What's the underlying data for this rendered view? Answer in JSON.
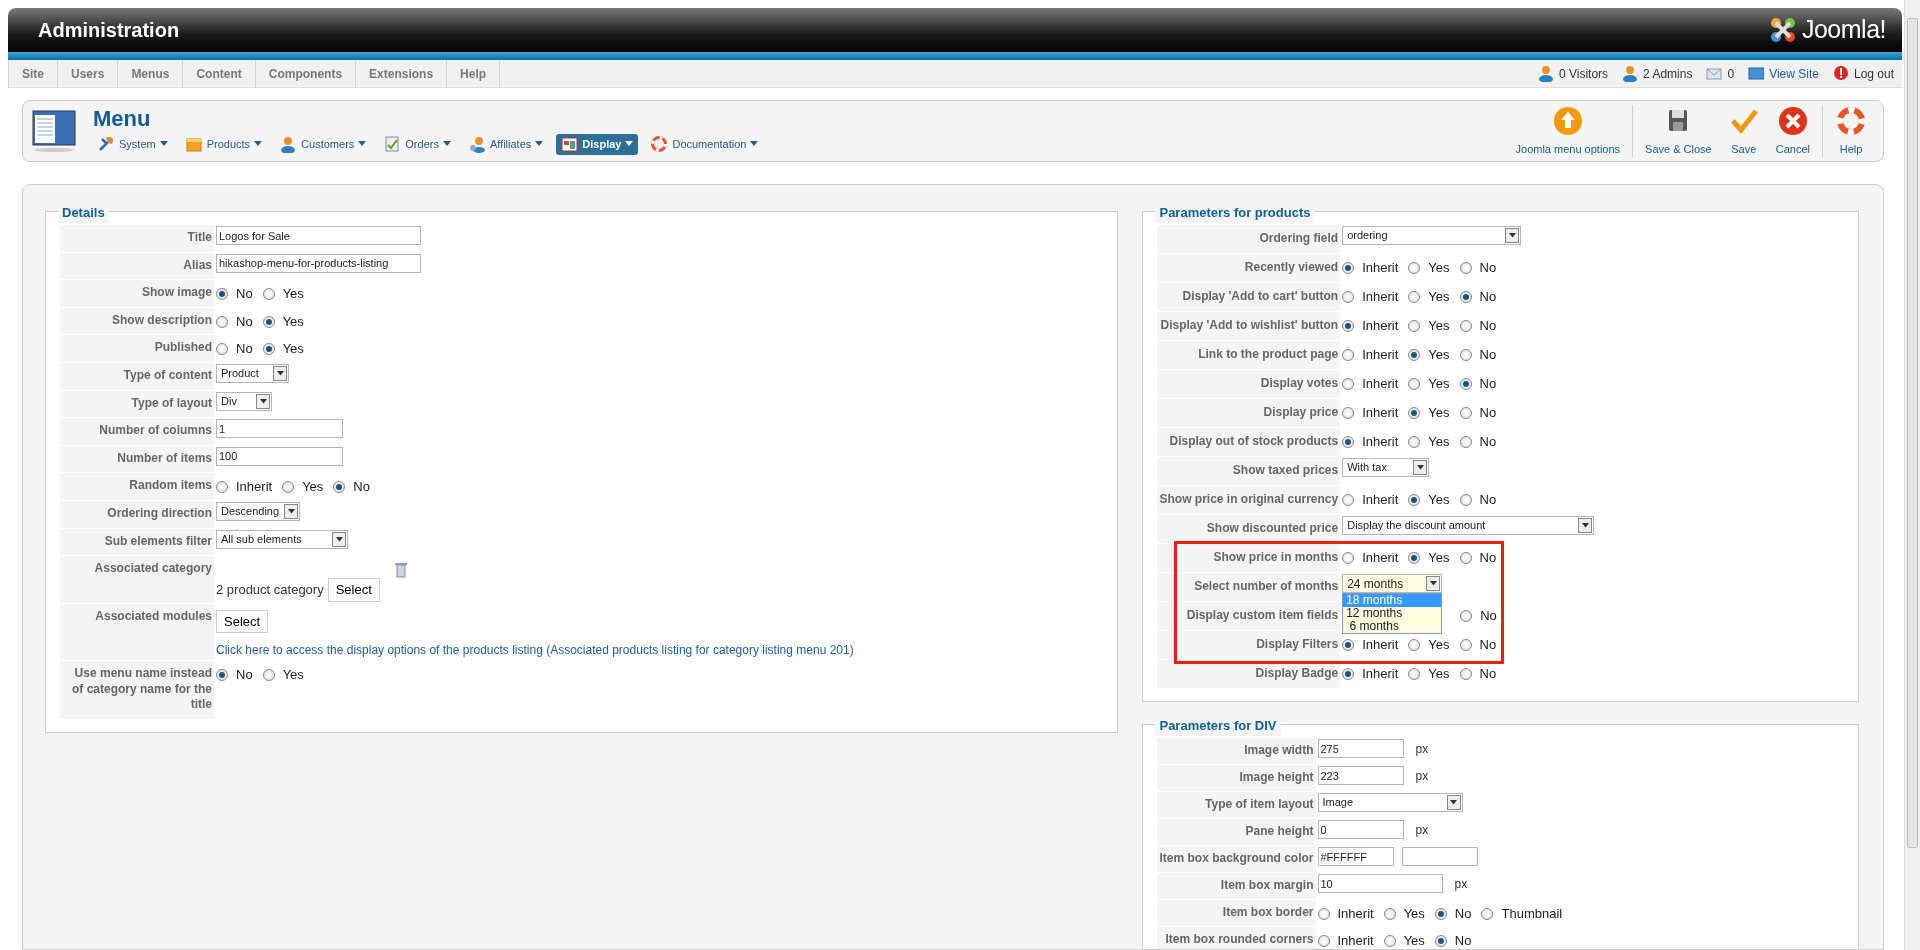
{
  "header": {
    "title": "Administration",
    "logo_text": "Joomla!"
  },
  "menu": [
    "Site",
    "Users",
    "Menus",
    "Content",
    "Components",
    "Extensions",
    "Help"
  ],
  "status": [
    {
      "kind": "visitors",
      "label": "0 Visitors"
    },
    {
      "kind": "admins",
      "label": "2 Admins"
    },
    {
      "kind": "messages",
      "label": "0"
    },
    {
      "kind": "viewsite",
      "label": "View Site"
    },
    {
      "kind": "logout",
      "label": "Log out"
    }
  ],
  "toolbar": {
    "title": "Menu",
    "submenu": [
      {
        "kind": "system",
        "label": "System",
        "selected": false
      },
      {
        "kind": "products",
        "label": "Products",
        "selected": false
      },
      {
        "kind": "customers",
        "label": "Customers",
        "selected": false
      },
      {
        "kind": "orders",
        "label": "Orders",
        "selected": false
      },
      {
        "kind": "affiliates",
        "label": "Affiliates",
        "selected": false
      },
      {
        "kind": "display",
        "label": "Display",
        "selected": true
      },
      {
        "kind": "documentation",
        "label": "Documentation",
        "selected": false
      }
    ],
    "action_groups": [
      [
        {
          "kind": "options",
          "label": "Joomla menu options"
        }
      ],
      [
        {
          "kind": "saveclose",
          "label": "Save & Close"
        },
        {
          "kind": "save",
          "label": "Save"
        },
        {
          "kind": "cancel",
          "label": "Cancel"
        }
      ],
      [
        {
          "kind": "help",
          "label": "Help"
        }
      ]
    ]
  },
  "fieldsets": [
    {
      "legend": "Details",
      "rows": [
        {
          "label": "Title",
          "kind": "text",
          "value": "Logos for Sale"
        },
        {
          "label": "Alias",
          "kind": "text",
          "value": "hikashop-menu-for-products-listing"
        },
        {
          "label": "Show image",
          "kind": "radio",
          "options": [
            {
              "label": "No",
              "selected": true
            },
            {
              "label": "Yes",
              "selected": false
            }
          ]
        },
        {
          "label": "Show description",
          "kind": "radio",
          "options": [
            {
              "label": "No",
              "selected": false
            },
            {
              "label": "Yes",
              "selected": true
            }
          ]
        },
        {
          "label": "Published",
          "kind": "radio",
          "options": [
            {
              "label": "No",
              "selected": false
            },
            {
              "label": "Yes",
              "selected": true
            }
          ]
        },
        {
          "label": "Type of content",
          "kind": "select",
          "value": "Product"
        },
        {
          "label": "Type of layout",
          "kind": "select",
          "value": "Div"
        },
        {
          "label": "Number of columns",
          "kind": "text",
          "value": "1"
        },
        {
          "label": "Number of items",
          "kind": "text",
          "value": "100"
        },
        {
          "label": "Random items",
          "kind": "radio",
          "options": [
            {
              "label": "Inherit",
              "selected": false
            },
            {
              "label": "Yes",
              "selected": false
            },
            {
              "label": "No",
              "selected": true
            }
          ]
        },
        {
          "label": "Ordering direction",
          "kind": "select",
          "value": "Descending"
        },
        {
          "label": "Sub elements filter",
          "kind": "select",
          "value": "All sub elements"
        },
        {
          "label": "Associated category",
          "kind": "category",
          "value": "2 product category",
          "button": "Select"
        },
        {
          "label": "Associated modules",
          "kind": "modules",
          "button": "Select",
          "link": "Click here to access the display options of the products listing (Associated products listing for category listing menu 201)"
        },
        {
          "label": "Use menu name instead of category name for the title",
          "kind": "radio",
          "options": [
            {
              "label": "No",
              "selected": true
            },
            {
              "label": "Yes",
              "selected": false
            }
          ]
        }
      ]
    },
    {
      "legend": "Parameters for products",
      "rows": [
        {
          "label": "Ordering field",
          "kind": "select",
          "value": "ordering",
          "highlighted": false
        },
        {
          "label": "Recently viewed",
          "kind": "radio",
          "highlighted": false,
          "options": [
            {
              "label": "Inherit",
              "selected": true
            },
            {
              "label": "Yes",
              "selected": false
            },
            {
              "label": "No",
              "selected": false
            }
          ]
        },
        {
          "label": "Display 'Add to cart' button",
          "kind": "radio",
          "highlighted": false,
          "options": [
            {
              "label": "Inherit",
              "selected": false
            },
            {
              "label": "Yes",
              "selected": false
            },
            {
              "label": "No",
              "selected": true
            }
          ]
        },
        {
          "label": "Display 'Add to wishlist' button",
          "kind": "radio",
          "highlighted": false,
          "options": [
            {
              "label": "Inherit",
              "selected": true
            },
            {
              "label": "Yes",
              "selected": false
            },
            {
              "label": "No",
              "selected": false
            }
          ]
        },
        {
          "label": "Link to the product page",
          "kind": "radio",
          "highlighted": false,
          "options": [
            {
              "label": "Inherit",
              "selected": false
            },
            {
              "label": "Yes",
              "selected": true
            },
            {
              "label": "No",
              "selected": false
            }
          ]
        },
        {
          "label": "Display votes",
          "kind": "radio",
          "highlighted": false,
          "options": [
            {
              "label": "Inherit",
              "selected": false
            },
            {
              "label": "Yes",
              "selected": false
            },
            {
              "label": "No",
              "selected": true
            }
          ]
        },
        {
          "label": "Display price",
          "kind": "radio",
          "highlighted": false,
          "options": [
            {
              "label": "Inherit",
              "selected": false
            },
            {
              "label": "Yes",
              "selected": true
            },
            {
              "label": "No",
              "selected": false
            }
          ]
        },
        {
          "label": "Display out of stock products",
          "kind": "radio",
          "highlighted": false,
          "options": [
            {
              "label": "Inherit",
              "selected": true
            },
            {
              "label": "Yes",
              "selected": false
            },
            {
              "label": "No",
              "selected": false
            }
          ]
        },
        {
          "label": "Show taxed prices",
          "kind": "select",
          "value": "With tax",
          "highlighted": false
        },
        {
          "label": "Show price in original currency",
          "kind": "radio",
          "highlighted": false,
          "options": [
            {
              "label": "Inherit",
              "selected": false
            },
            {
              "label": "Yes",
              "selected": true
            },
            {
              "label": "No",
              "selected": false
            }
          ]
        },
        {
          "label": "Show discounted price",
          "kind": "select",
          "value": "Display the discount amount",
          "highlighted": false
        },
        {
          "label": "Show price in months",
          "kind": "radio",
          "highlighted": true,
          "options": [
            {
              "label": "Inherit",
              "selected": false
            },
            {
              "label": "Yes",
              "selected": true
            },
            {
              "label": "No",
              "selected": false
            }
          ]
        },
        {
          "label": "Select number of months",
          "kind": "select",
          "value": "24 months",
          "highlighted": true,
          "open_options": [
            {
              "label": "18 months",
              "selected": true
            },
            {
              "label": "12 months",
              "selected": false
            },
            {
              "label": " 6 months",
              "selected": false
            }
          ]
        },
        {
          "label": "Display custom item fields",
          "kind": "radio_covered",
          "highlighted": true,
          "options": [
            {
              "label": "No",
              "selected": false
            }
          ]
        },
        {
          "label": "Display Filters",
          "kind": "radio",
          "highlighted": true,
          "options": [
            {
              "label": "Inherit",
              "selected": true
            },
            {
              "label": "Yes",
              "selected": false
            },
            {
              "label": "No",
              "selected": false
            }
          ]
        },
        {
          "label": "Display Badge",
          "kind": "radio",
          "highlighted": false,
          "options": [
            {
              "label": "Inherit",
              "selected": true
            },
            {
              "label": "Yes",
              "selected": false
            },
            {
              "label": "No",
              "selected": false
            }
          ]
        }
      ]
    },
    {
      "legend": "Parameters for DIV",
      "rows": [
        {
          "label": "Image width",
          "kind": "text",
          "value": "275",
          "suffix": "px"
        },
        {
          "label": "Image height",
          "kind": "text",
          "value": "223",
          "suffix": "px"
        },
        {
          "label": "Type of item layout",
          "kind": "select",
          "value": "Image"
        },
        {
          "label": "Pane height",
          "kind": "text",
          "value": "0",
          "suffix": "px"
        },
        {
          "label": "Item box background color",
          "kind": "color",
          "value": "#FFFFFF"
        },
        {
          "label": "Item box margin",
          "kind": "text",
          "value": "10",
          "suffix": "px"
        },
        {
          "label": "Item box border",
          "kind": "radio",
          "options": [
            {
              "label": "Inherit",
              "selected": false
            },
            {
              "label": "Yes",
              "selected": false
            },
            {
              "label": "No",
              "selected": true
            },
            {
              "label": "Thumbnail",
              "selected": false
            }
          ]
        },
        {
          "label": "Item box rounded corners",
          "kind": "radio",
          "options": [
            {
              "label": "Inherit",
              "selected": false
            },
            {
              "label": "Yes",
              "selected": false
            },
            {
              "label": "No",
              "selected": true
            }
          ]
        }
      ]
    }
  ]
}
